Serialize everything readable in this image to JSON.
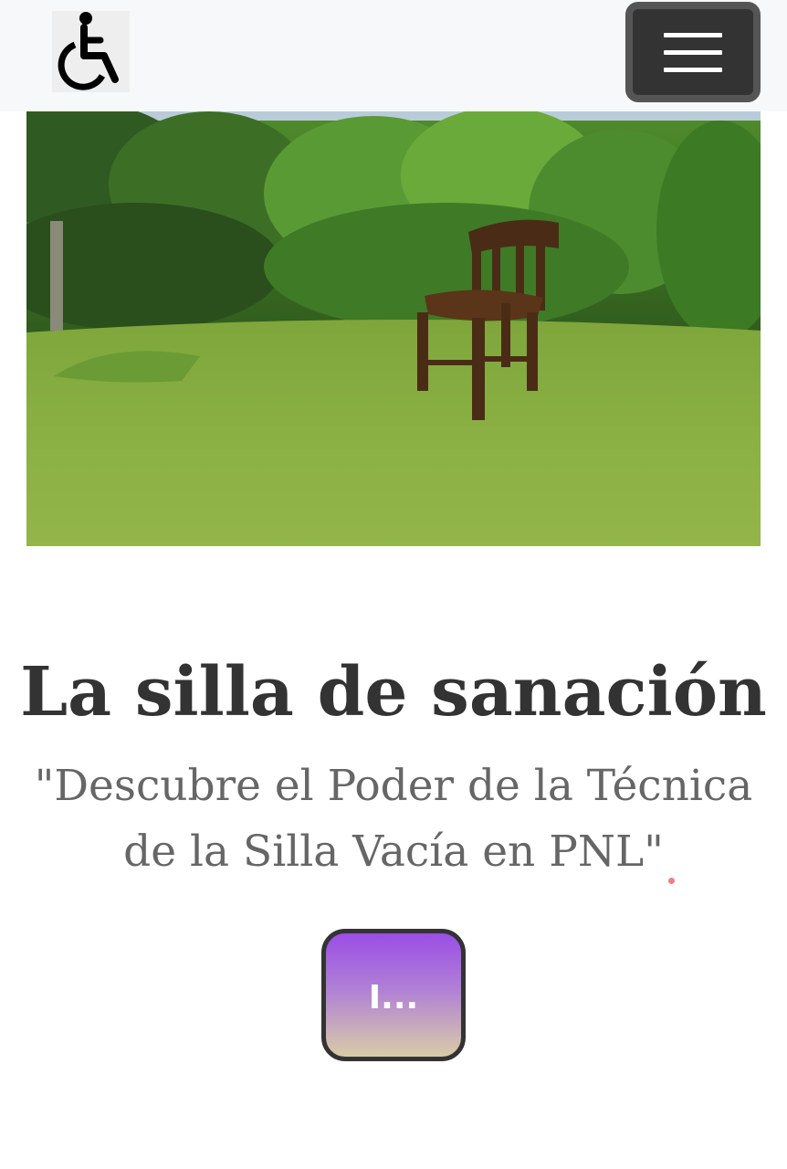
{
  "header": {
    "accessibility_icon": "wheelchair-icon",
    "menu_icon": "hamburger-menu-icon"
  },
  "hero": {
    "image": "wooden-chair-on-grass-photo"
  },
  "main": {
    "title": "La silla de sanación",
    "subtitle": "\"Descubre el Poder de la Técnica de la Silla Vacía en PNL\"",
    "cta_label": "I..."
  },
  "colors": {
    "header_bg": "#f7f8fa",
    "menu_bg": "#333333",
    "title": "#333333",
    "subtitle": "#666666",
    "cta_top": "#9b4ee6",
    "cta_bottom": "#d9cca6"
  }
}
